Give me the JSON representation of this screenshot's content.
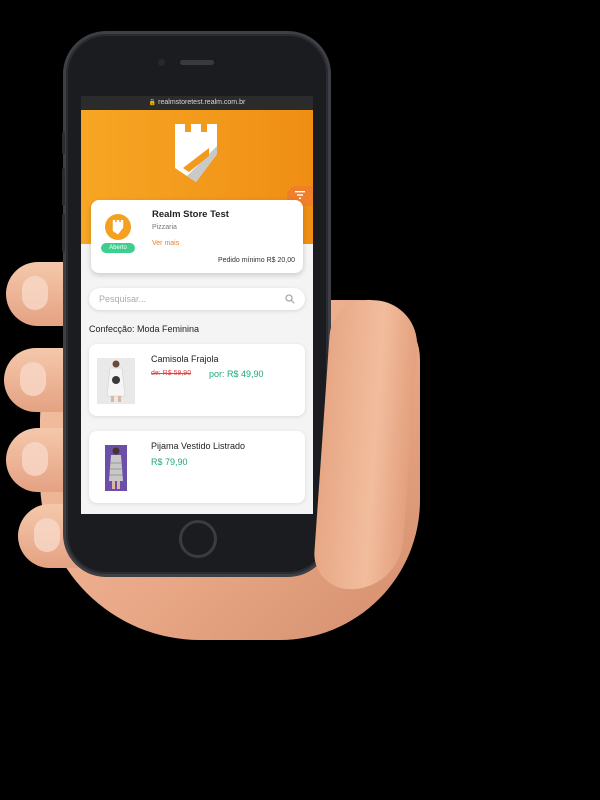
{
  "browser": {
    "url": "realmstoretest.realm.com.br"
  },
  "store": {
    "name": "Realm Store Test",
    "category": "Pizzaria",
    "see_more": "Ver mais",
    "status": "Aberto",
    "min_order": "Pedido mínimo R$ 20,00"
  },
  "search": {
    "placeholder": "Pesquisar..."
  },
  "section": {
    "title": "Confecção: Moda Feminina"
  },
  "products": [
    {
      "name": "Camisola Frajola",
      "old_price": "de: R$ 59,90",
      "price": "por: R$ 49,90"
    },
    {
      "name": "Pijama Vestido Listrado",
      "price": "R$ 79,90"
    }
  ],
  "icons": {
    "url_lock": "lock-icon",
    "logo": "castle-logo-icon",
    "filter": "filter-icon",
    "search": "search-icon"
  },
  "colors": {
    "brand_orange": "#f59e1f",
    "accent_orange": "#ef7f28",
    "price_green": "#1fa67a",
    "open_green": "#3ecf8e",
    "old_price_red": "#e04646"
  }
}
